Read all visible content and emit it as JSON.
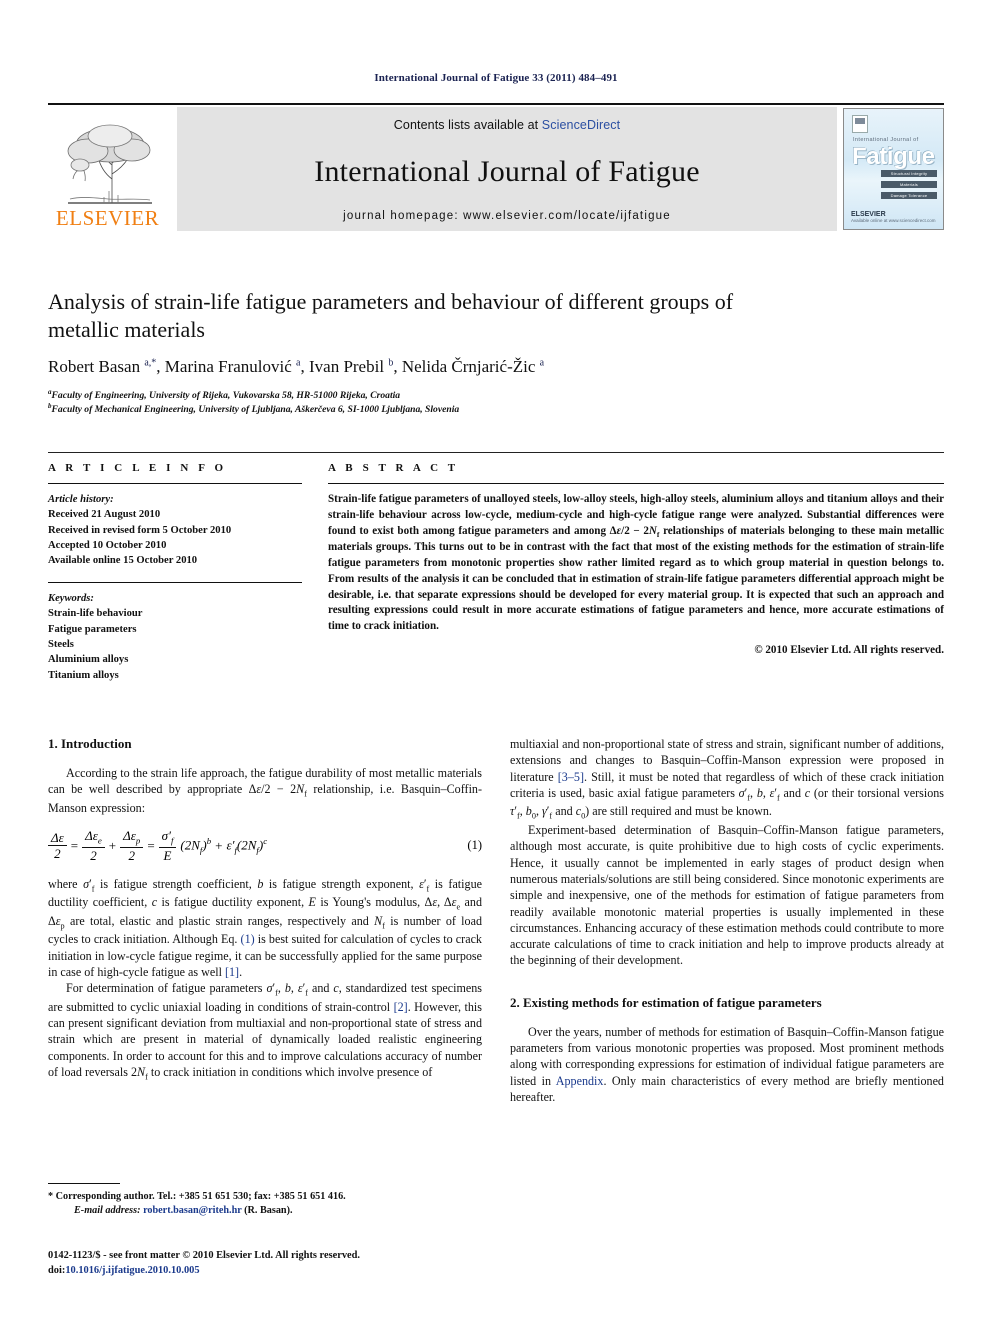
{
  "running_head": "International Journal of Fatigue 33 (2011) 484–491",
  "masthead": {
    "publisher_logo_text": "ELSEVIER",
    "contents_prefix": "Contents lists available at ",
    "contents_link": "ScienceDirect",
    "journal_name": "International Journal of Fatigue",
    "homepage": "journal homepage: www.elsevier.com/locate/ijfatigue",
    "cover": {
      "supertitle": "International Journal of",
      "title": "Fatigue",
      "bars": [
        "Structural Integrity",
        "Materials",
        "Damage Tolerance"
      ],
      "footer_brand": "ELSEVIER",
      "footer_note": "Available online at www.sciencedirect.com"
    }
  },
  "article": {
    "title": "Analysis of strain-life fatigue parameters and behaviour of different groups of metallic materials",
    "authors_html": "Robert Basan <sup>a,*</sup>, Marina Franulović <sup>a</sup>, Ivan Prebil <sup>b</sup>, Nelida Črnjarić-Žic <sup>a</sup>",
    "affiliation_a": "Faculty of Engineering, University of Rijeka, Vukovarska 58, HR-51000 Rijeka, Croatia",
    "affiliation_b": "Faculty of Mechanical Engineering, University of Ljubljana, Aškerčeva 6, SI-1000 Ljubljana, Slovenia"
  },
  "article_info": {
    "heading": "A R T I C L E  I N F O",
    "history_label": "Article history:",
    "history": [
      "Received 21 August 2010",
      "Received in revised form 5 October 2010",
      "Accepted 10 October 2010",
      "Available online 15 October 2010"
    ],
    "keywords_label": "Keywords:",
    "keywords": [
      "Strain-life behaviour",
      "Fatigue parameters",
      "Steels",
      "Aluminium alloys",
      "Titanium alloys"
    ]
  },
  "abstract": {
    "heading": "A B S T R A C T",
    "text_html": "Strain-life fatigue parameters of unalloyed steels, low-alloy steels, high-alloy steels, aluminium alloys and titanium alloys and their strain-life behaviour across low-cycle, medium-cycle and high-cycle fatigue range were analyzed. Substantial differences were found to exist both among fatigue parameters and among &Delta;<i>&epsilon;</i>/2 &minus; 2<i>N</i><sub>f</sub> relationships of materials belonging to these main metallic materials groups. This turns out to be in contrast with the fact that most of the existing methods for the estimation of strain-life fatigue parameters from monotonic properties show rather limited regard as to which group material in question belongs to. From results of the analysis it can be concluded that in estimation of strain-life fatigue parameters differential approach might be desirable, i.e. that separate expressions should be developed for every material group. It is expected that such an approach and resulting expressions could result in more accurate estimations of fatigue parameters and hence, more accurate estimations of time to crack initiation.",
    "copyright": "© 2010 Elsevier Ltd. All rights reserved."
  },
  "sections": {
    "intro_heading": "1. Introduction",
    "intro_p1_html": "According to the strain life approach, the fatigue durability of most metallic materials can be well described by appropriate &Delta;<i>&epsilon;</i>/2 &minus; 2<i>N</i><sub>f</sub> relationship, i.e. Basquin–Coffin-Manson expression:",
    "equation_number": "(1)",
    "intro_p2_html": "where <i>&sigma;</i>&prime;<sub>f</sub> is fatigue strength coefficient, <i>b</i> is fatigue strength exponent, <i>&epsilon;</i>&prime;<sub>f</sub> is fatigue ductility coefficient, <i>c</i> is fatigue ductility exponent, <i>E</i> is Young's modulus, &Delta;<i>&epsilon;</i>, &Delta;<i>&epsilon;</i><sub>e</sub> and &Delta;<i>&epsilon;</i><sub>p</sub> are total, elastic and plastic strain ranges, respectively and <i>N</i><sub>f</sub> is number of load cycles to crack initiation. Although Eq. <span class=\"ref\">(1)</span> is best suited for calculation of cycles to crack initiation in low-cycle fatigue regime, it can be successfully applied for the same purpose in case of high-cycle fatigue as well <span class=\"ref\">[1]</span>.",
    "intro_p3_html": "For determination of fatigue parameters <i>&sigma;</i>&prime;<sub>f</sub>, <i>b</i>, <i>&epsilon;</i>&prime;<sub>f</sub> and <i>c</i>, standardized test specimens are submitted to cyclic uniaxial loading in conditions of strain-control <span class=\"ref\">[2]</span>. However, this can present significant deviation from multiaxial and non-proportional state of stress and strain which are present in material of dynamically loaded realistic engineering components. In order to account for this and to improve calculations accuracy of number of load reversals 2<i>N</i><sub>f</sub> to crack initiation in conditions which involve presence of",
    "intro_p4_html": "multiaxial and non-proportional state of stress and strain, significant number of additions, extensions and changes to Basquin–Coffin-Manson expression were proposed in literature <span class=\"ref\">[3–5]</span>. Still, it must be noted that regardless of which of these crack initiation criteria is used, basic axial fatigue parameters <i>&sigma;</i>&prime;<sub>f</sub>, <i>b</i>, <i>&epsilon;</i>&prime;<sub>f</sub> and <i>c</i> (or their torsional versions <i>&tau;</i>&prime;<sub>f</sub>, <i>b</i><sub>0</sub>, <i>&gamma;</i>&prime;<sub>f</sub> and <i>c</i><sub>0</sub>) are still required and must be known.",
    "intro_p5_html": "Experiment-based determination of Basquin–Coffin-Manson fatigue parameters, although most accurate, is quite prohibitive due to high costs of cyclic experiments. Hence, it usually cannot be implemented in early stages of product design when numerous materials/solutions are still being considered. Since monotonic experiments are simple and inexpensive, one of the methods for estimation of fatigue parameters from readily available monotonic material properties is usually implemented in these circumstances. Enhancing accuracy of these estimation methods could contribute to more accurate calculations of time to crack initiation and help to improve products already at the beginning of their development.",
    "existing_heading": "2. Existing methods for estimation of fatigue parameters",
    "existing_p1_html": "Over the years, number of methods for estimation of Basquin–Coffin-Manson fatigue parameters from various monotonic properties was proposed. Most prominent methods along with corresponding expressions for estimation of individual fatigue parameters are listed in <span class=\"link\">Appendix</span>. Only main characteristics of every method are briefly mentioned hereafter."
  },
  "footnote": {
    "corresponding_html": "* Corresponding author. Tel.: +385 51 651 530; fax: +385 51 651 416.",
    "email_html": "<i>E-mail address:</i> <span class=\"mail\">robert.basan@riteh.hr</span> (R. Basan)."
  },
  "footer": {
    "issn_line_html": "0142-1123/$ - see front matter &copy; 2010 Elsevier Ltd. All rights reserved.",
    "doi_html": "doi:<span class=\"doi\">10.1016/j.ijfatigue.2010.10.005</span>"
  },
  "colors": {
    "elsevier_orange": "#F07F13",
    "link_blue": "#1b3a8c",
    "running_head_navy": "#1b2352",
    "band_gray": "#e3e3e3"
  }
}
